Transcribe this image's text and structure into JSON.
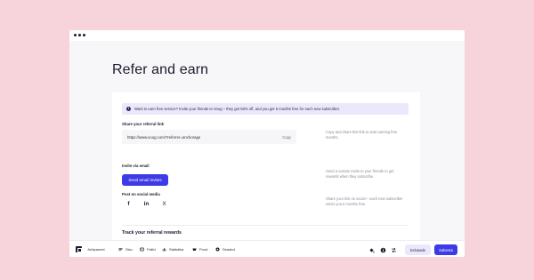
{
  "page": {
    "title": "Refer and earn"
  },
  "banner": {
    "text": "Want to earn free service? Invite your friends to Voog – they get 50% off, and you get 6 months free for each new subscriber."
  },
  "referral": {
    "label": "Share your referral link",
    "link": "https://www.voog.com/?referrer=anchorage",
    "copy_label": "Copy",
    "hint": "Copy and share this link to start earning free months."
  },
  "invite": {
    "label": "Invite via email",
    "button_label": "Send email invites",
    "hint": "Send a custom invite to your friends to get rewards when they subscribe."
  },
  "social": {
    "label": "Post on social media",
    "facebook": "f",
    "linkedin": "in",
    "x": "X",
    "hint": "Share your link on social – each new subscriber earns you 6 months free."
  },
  "track": {
    "title": "Track your referral rewards"
  },
  "bottombar": {
    "site_name": "Juhtpaneel",
    "items": [
      {
        "label": "Sisu",
        "icon": "pages-icon"
      },
      {
        "label": "Failid",
        "icon": "files-icon"
      },
      {
        "label": "Statistika",
        "icon": "stats-icon"
      },
      {
        "label": "Pood",
        "icon": "store-icon"
      },
      {
        "label": "Seaded",
        "icon": "settings-icon"
      }
    ],
    "preview_label": "Eelvaade",
    "publish_label": "Salvesta"
  },
  "colors": {
    "background": "#f7d4dc",
    "accent": "#3c3be6",
    "banner": "#ece8fb"
  }
}
